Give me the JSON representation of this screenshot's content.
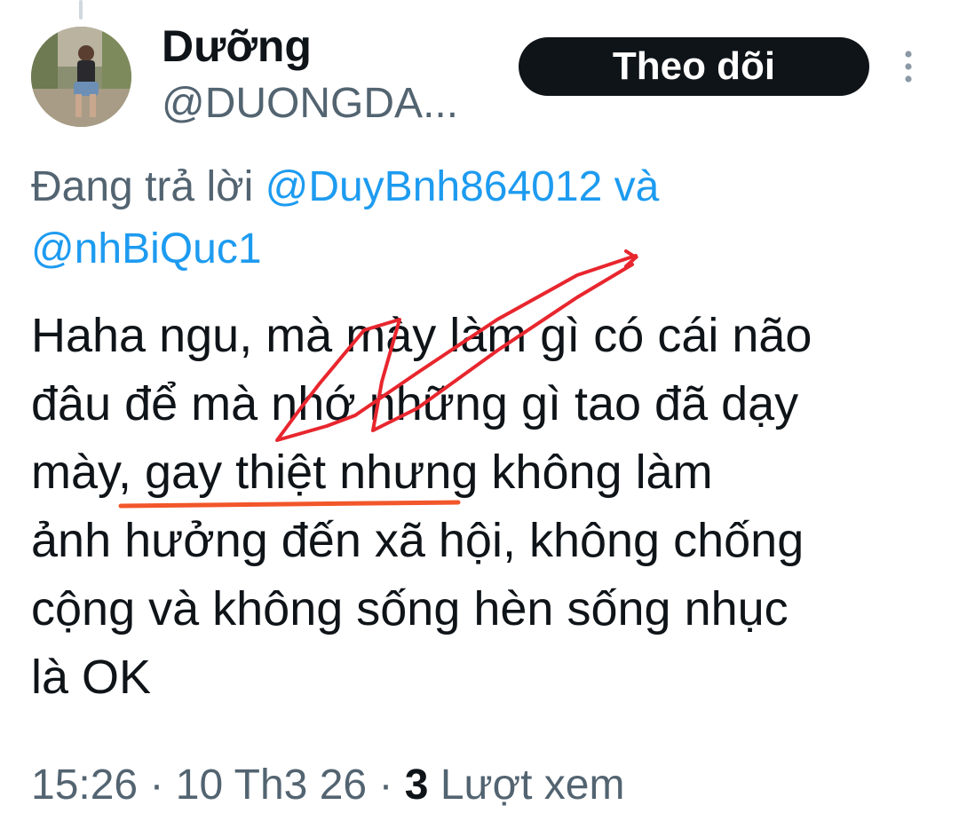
{
  "author": {
    "display_name": "Dưỡng",
    "handle": "@DUONGDA..."
  },
  "follow_button": {
    "label": "Theo dõi"
  },
  "more_menu": {
    "icon": "more-vertical-icon"
  },
  "reply_context": {
    "prefix": "Đang trả lời",
    "mentions": [
      "@DuyBnh864012",
      "@nhBiQuc1"
    ],
    "conjunction": "và"
  },
  "tweet": {
    "text": "Haha ngu, mà mày làm gì có cái não\nđâu để mà nhớ những gì tao đã dạy\nmày, gay thiệt nhưng không làm\nảnh hưởng đến xã hội, không chống\ncộng và không sống hèn sống nhục\nlà OK"
  },
  "meta": {
    "time": "15:26",
    "separator": "·",
    "date": "10 Th3 26",
    "views_count": "3",
    "views_label": "Lượt xem"
  },
  "colors": {
    "text": "#0f1419",
    "secondary": "#536471",
    "link": "#1d9bf0",
    "button_bg": "#0f1419",
    "annotation_red": "#e8262e",
    "annotation_underline": "#f2562a"
  }
}
